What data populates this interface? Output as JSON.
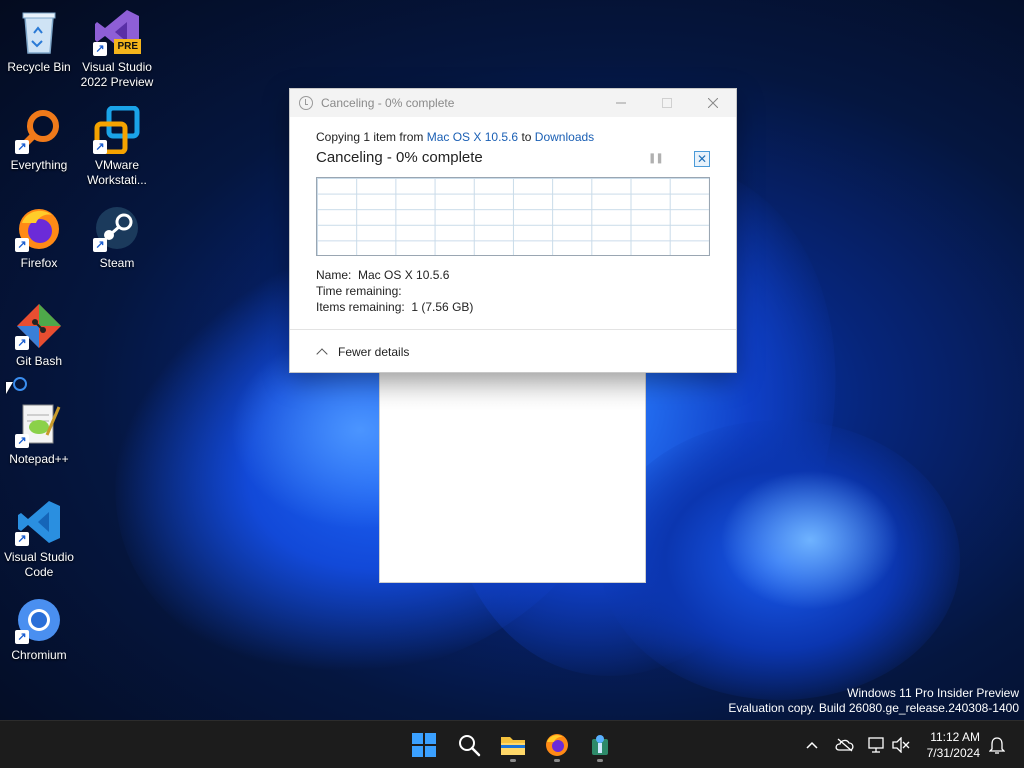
{
  "desktop": {
    "icons": [
      {
        "label": "Recycle Bin"
      },
      {
        "label": "Visual Studio 2022 Preview",
        "badge": "PRE"
      },
      {
        "label": "Everything"
      },
      {
        "label": "VMware Workstati..."
      },
      {
        "label": "Firefox"
      },
      {
        "label": "Steam"
      },
      {
        "label": "Git Bash"
      },
      {
        "label": "Notepad++"
      },
      {
        "label": "Visual Studio Code"
      },
      {
        "label": "Chromium"
      }
    ],
    "watermark": {
      "line1": "Windows 11 Pro Insider Preview",
      "line2": "Evaluation copy. Build 26080.ge_release.240308-1400"
    }
  },
  "dialog": {
    "title": "Canceling - 0% complete",
    "copy_prefix": "Copying 1 item from ",
    "source": "Mac OS X 10.5.6",
    "copy_to": " to ",
    "destination": "Downloads",
    "status_heading": "Canceling - 0% complete",
    "pause_icon": "pause-icon",
    "cancel_icon": "close-icon",
    "name_label": "Name:",
    "name_value": "Mac OS X 10.5.6",
    "time_label": "Time remaining:",
    "time_value": "",
    "items_label": "Items remaining:",
    "items_value": "1 (7.56 GB)",
    "details_toggle": "Fewer details",
    "progress_percent": 0
  },
  "taskbar": {
    "apps": [
      "start",
      "search",
      "file-explorer",
      "firefox",
      "app-4"
    ],
    "time": "11:12 AM",
    "date": "7/31/2024"
  },
  "colors": {
    "link": "#1a5fb4",
    "accent": "#0067c0"
  }
}
